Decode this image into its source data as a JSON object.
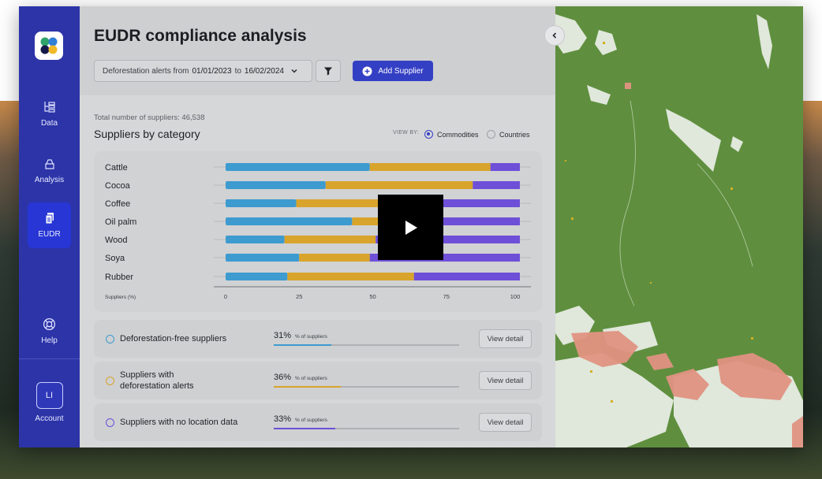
{
  "colors": {
    "commodity_seg1": "#3d9bd0",
    "commodity_seg2": "#d9a42c",
    "commodity_seg3": "#6e4fd8",
    "accent": "#3440c4",
    "sidebar": "#2c34a8"
  },
  "sidebar": {
    "logo_icon": "app-logo",
    "items": [
      {
        "label": "Data",
        "icon": "data-tree-icon"
      },
      {
        "label": "Analysis",
        "icon": "box-icon"
      },
      {
        "label": "EUDR",
        "icon": "documents-icon"
      },
      {
        "label": "Help",
        "icon": "lifebuoy-icon"
      },
      {
        "label": "Account",
        "icon": "avatar"
      }
    ],
    "avatar_initials": "LI"
  },
  "header": {
    "title": "EUDR compliance analysis",
    "daterange_prefix": "Deforestation alerts from",
    "date_from": "01/01/2023",
    "date_to_word": "to",
    "date_to": "16/02/2024",
    "filter_icon": "funnel-icon",
    "add_supplier": "Add Supplier"
  },
  "summary": {
    "total": "Total number of suppliers: 46,538",
    "section_title": "Suppliers by category"
  },
  "viewby": {
    "label": "VIEW BY:",
    "options": [
      "Commodities",
      "Countries"
    ],
    "selected": "Commodities"
  },
  "chart_data": {
    "type": "bar",
    "stacked": true,
    "orientation": "horizontal",
    "categories": [
      "Cattle",
      "Cocoa",
      "Coffee",
      "Oil palm",
      "Wood",
      "Soya",
      "Rubber"
    ],
    "series": [
      {
        "values": [
          49,
          34,
          24,
          43,
          20,
          25,
          21
        ]
      },
      {
        "values": [
          41,
          50,
          28,
          25,
          31,
          24,
          43
        ]
      },
      {
        "values": [
          10,
          16,
          48,
          32,
          49,
          51,
          36
        ]
      }
    ],
    "xlabel": "Suppliers (%)",
    "xticks": [
      "0",
      "25",
      "50",
      "75",
      "100"
    ],
    "xlim": [
      0,
      100
    ]
  },
  "kpis": [
    {
      "label": "Deforestation-free suppliers",
      "pct": "31%",
      "pct_value": 31,
      "sub": "% of suppliers",
      "button": "View detail",
      "color": "#3d9bd0"
    },
    {
      "label": "Suppliers with deforestation alerts",
      "pct": "36%",
      "pct_value": 36,
      "sub": "% of suppliers",
      "button": "View detail",
      "color": "#d9a42c"
    },
    {
      "label": "Suppliers with no location data",
      "pct": "33%",
      "pct_value": 33,
      "sub": "% of suppliers",
      "button": "View detail",
      "color": "#6e4fd8"
    }
  ],
  "controls": {
    "collapse_icon": "chevron-left-icon",
    "play_icon": "play-icon"
  }
}
